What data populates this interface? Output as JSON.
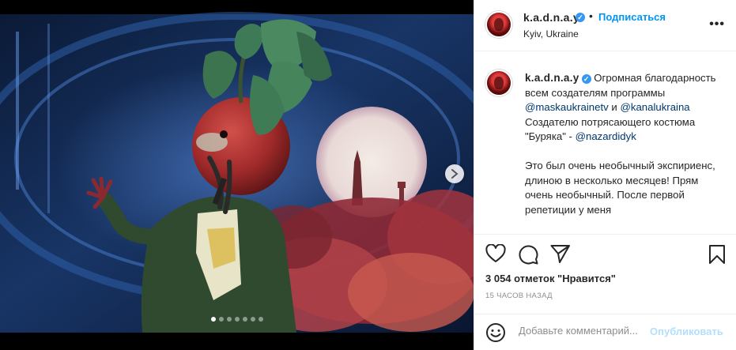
{
  "post": {
    "username": "k.a.d.n.a.y",
    "verified_icon": "verified-badge-icon",
    "follow_label": "Подписаться",
    "location": "Kyiv, Ukraine",
    "bullet": "•",
    "more_label": "•••",
    "image_count": 7,
    "active_image": 1
  },
  "caption": {
    "username": "k.a.d.n.a.y",
    "text_1": "Огромная благодарность всем создателям программы",
    "mention_1": "@maskaukrainetv",
    "text_2": "и",
    "mention_2": "@kanalukraina",
    "line_3": "Создателю потрясающего костюма \"Буряка\" -",
    "mention_3": "@nazardidyk",
    "para_2": "Это был очень необычный экспириенс, длиною в несколько месяцев! Прям очень необычный. После первой репетиции у меня"
  },
  "actions": {
    "like_icon": "heart-icon",
    "comment_icon": "comment-icon",
    "share_icon": "paper-plane-icon",
    "save_icon": "bookmark-icon",
    "likes_text": "3 054 отметок \"Нравится\"",
    "time_text": "15 часов назад"
  },
  "comment": {
    "emoji_icon": "emoji-icon",
    "placeholder": "Добавьте комментарий...",
    "publish_label": "Опубликовать"
  },
  "colors": {
    "link_blue": "#0095f6",
    "mention": "#00376b",
    "publish_disabled": "#b2dffc",
    "verified": "#3897f0"
  }
}
